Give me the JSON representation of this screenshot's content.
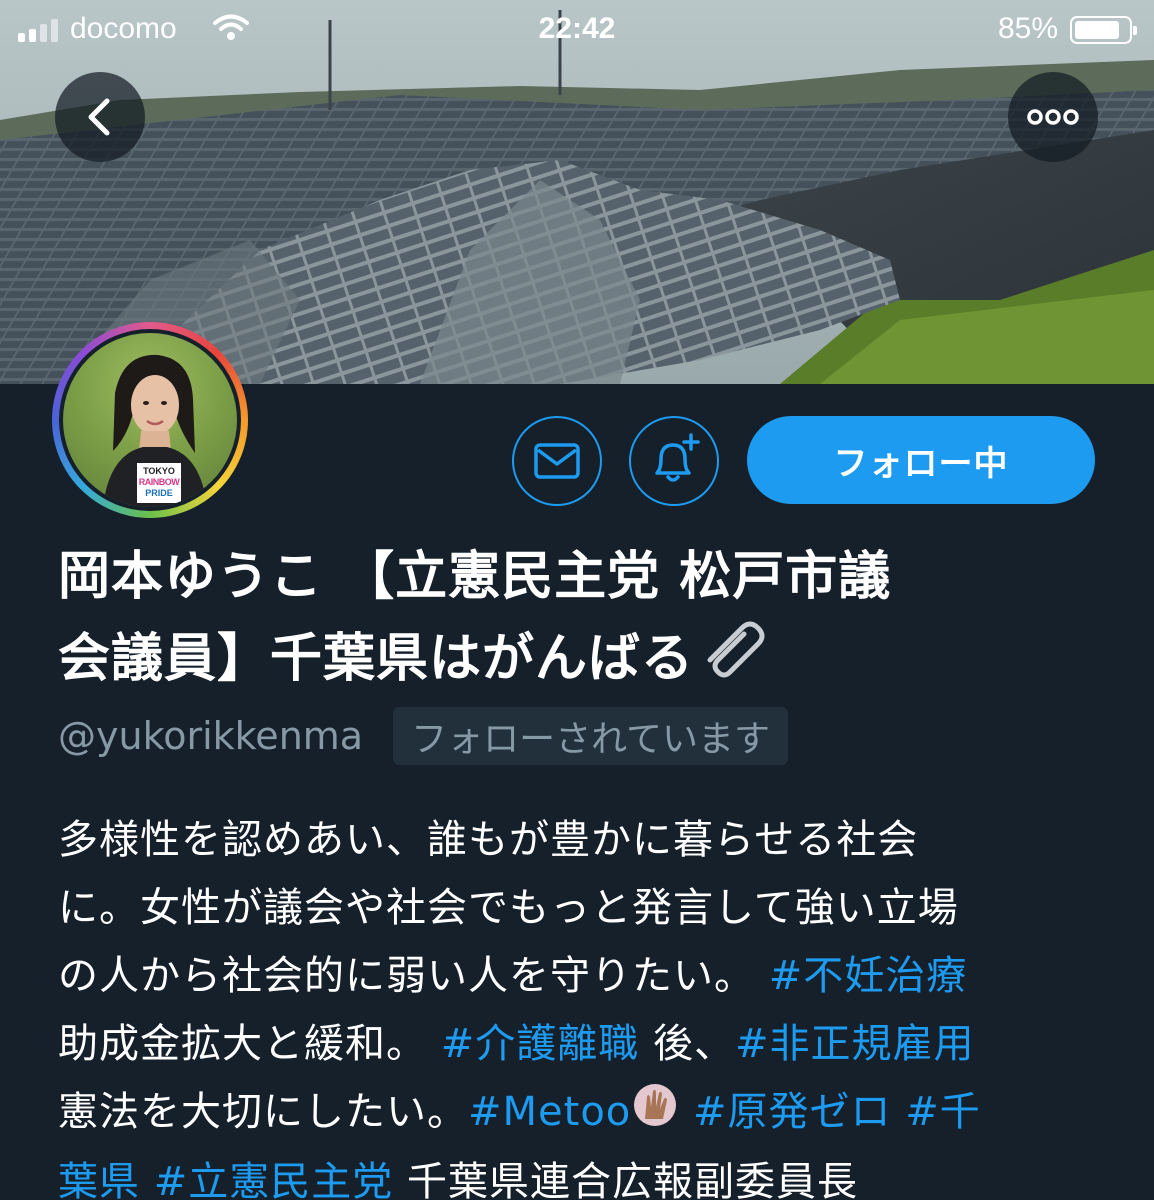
{
  "status_bar": {
    "carrier": "docomo",
    "time": "22:42",
    "battery_percent_label": "85%",
    "battery_level": 0.85
  },
  "nav": {
    "back_icon": "chevron-left-icon",
    "more_icon": "ellipsis-icon"
  },
  "avatar": {
    "badge_line1": "TOKYO",
    "badge_line2": "RAINBOW",
    "badge_line3": "PRIDE"
  },
  "actions": {
    "dm_icon": "envelope-icon",
    "notify_icon": "bell-plus-icon",
    "follow_label": "フォロー中"
  },
  "profile": {
    "name_line1": "岡本ゆうこ 【立憲民主党 松戸市議",
    "name_line2": "会議員】千葉県はがんばる",
    "handle": "@yukorikkenma",
    "follows_you": "フォローされています"
  },
  "bio": {
    "line1": "多様性を認めあい、誰もが豊かに暮らせる社会",
    "line2": "に。女性が議会や社会でもっと発言して強い立場",
    "line3_text": "の人から社会的に弱い人を守りたい。",
    "line3_tag": "#不妊治療",
    "line4_text1": "助成金拡大と緩和。",
    "line4_tag1": "#介護離職",
    "line4_text2": "後、",
    "line4_tag2": "#非正規雇用",
    "line5_text": "憲法を大切にしたい。",
    "line5_tag1": "#Metoo",
    "line5_tag2": "#原発ゼロ",
    "line5_tag3": "#千",
    "line6_tag1": "葉県",
    "line6_tag2": "#立憲民主党",
    "line6_text": "千葉県連合広報副委員長"
  },
  "colors": {
    "background": "#15202b",
    "accent": "#1d9bf0",
    "secondary_text": "#8899a6"
  }
}
